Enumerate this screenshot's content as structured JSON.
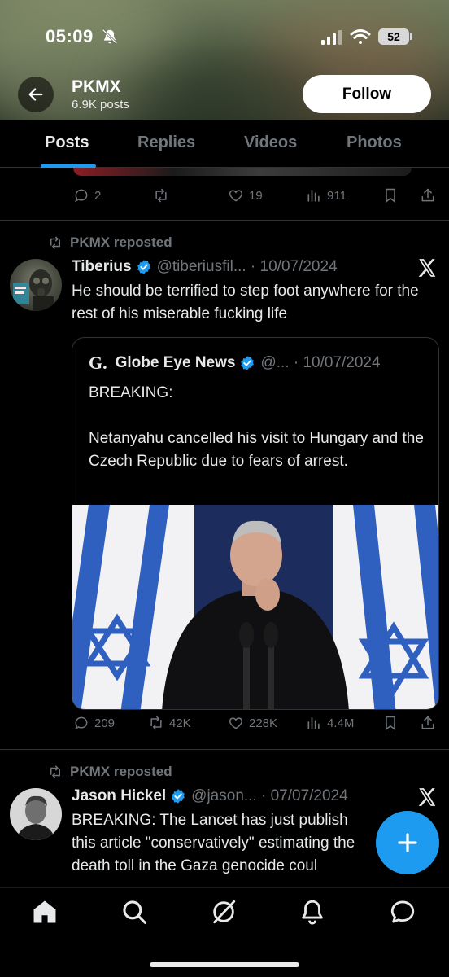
{
  "status_bar": {
    "time": "05:09",
    "battery": "52"
  },
  "header": {
    "profile_name": "PKMX",
    "post_count": "6.9K posts",
    "follow_label": "Follow"
  },
  "tabs": [
    {
      "label": "Posts",
      "active": true
    },
    {
      "label": "Replies",
      "active": false
    },
    {
      "label": "Videos",
      "active": false
    },
    {
      "label": "Photos",
      "active": false
    }
  ],
  "colors": {
    "accent": "#1d9bf0",
    "muted_text": "#71767b",
    "divider": "#2f3336"
  },
  "prev_post": {
    "replies": "2",
    "likes": "19",
    "views": "911"
  },
  "posts": [
    {
      "repost_label": "PKMX reposted",
      "author_name": "Tiberius",
      "meta": "@tiberiusfil... · 10/07/2024",
      "text": "He should be terrified to step foot anywhere for the rest of his miserable fucking life",
      "quote": {
        "logo": "G.",
        "author_name": "Globe Eye News",
        "meta": "@... · 10/07/2024",
        "text_line1": "BREAKING:",
        "text_line2": "Netanyahu cancelled his visit to Hungary and the Czech Republic due to fears of arrest."
      },
      "stats": {
        "replies": "209",
        "reposts": "42K",
        "likes": "228K",
        "views": "4.4M"
      }
    },
    {
      "repost_label": "PKMX reposted",
      "author_name": "Jason Hickel",
      "meta": "@jason... · 07/07/2024",
      "text": "BREAKING: The Lancet has just publish this article \"conservatively\" estimating the death toll in the Gaza genocide coul"
    }
  ],
  "icons": {
    "back": "arrow-left-icon",
    "verified": "verified-badge-icon",
    "x": "x-logo-icon",
    "compose": "plus-icon",
    "nav": [
      "home-icon",
      "search-icon",
      "grok-icon",
      "bell-icon",
      "messages-icon"
    ]
  }
}
